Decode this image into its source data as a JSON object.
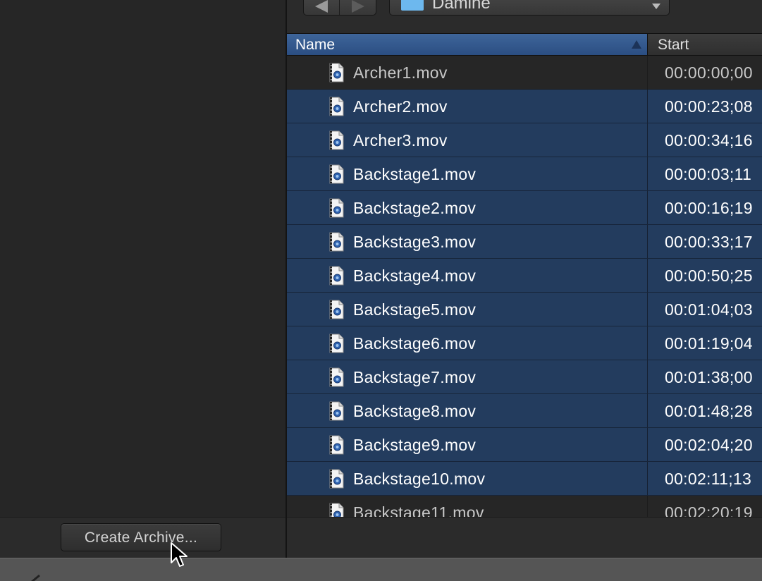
{
  "toolbar": {
    "location": "Damine",
    "folder_color": "#6db8ee"
  },
  "table": {
    "columns": {
      "name": "Name",
      "start": "Start"
    },
    "sort_direction": "ascending",
    "rows": [
      {
        "name": "Archer1.mov",
        "start": "00:00:00;00",
        "selected": false
      },
      {
        "name": "Archer2.mov",
        "start": "00:00:23;08",
        "selected": true
      },
      {
        "name": "Archer3.mov",
        "start": "00:00:34;16",
        "selected": true
      },
      {
        "name": "Backstage1.mov",
        "start": "00:00:03;11",
        "selected": true
      },
      {
        "name": "Backstage2.mov",
        "start": "00:00:16;19",
        "selected": true
      },
      {
        "name": "Backstage3.mov",
        "start": "00:00:33;17",
        "selected": true
      },
      {
        "name": "Backstage4.mov",
        "start": "00:00:50;25",
        "selected": true
      },
      {
        "name": "Backstage5.mov",
        "start": "00:01:04;03",
        "selected": true
      },
      {
        "name": "Backstage6.mov",
        "start": "00:01:19;04",
        "selected": true
      },
      {
        "name": "Backstage7.mov",
        "start": "00:01:38;00",
        "selected": true
      },
      {
        "name": "Backstage8.mov",
        "start": "00:01:48;28",
        "selected": true
      },
      {
        "name": "Backstage9.mov",
        "start": "00:02:04;20",
        "selected": true
      },
      {
        "name": "Backstage10.mov",
        "start": "00:02:11;13",
        "selected": true
      },
      {
        "name": "Backstage11.mov",
        "start": "00:02:20;19",
        "selected": false
      }
    ]
  },
  "footer": {
    "create_archive_label": "Create Archive..."
  },
  "colors": {
    "selection": "#233c5e",
    "header_selected": "#3e659a",
    "background": "#262626"
  },
  "icons": {
    "row_icon": "quicktime-movie-file-icon",
    "nav_back": "back-arrow-icon",
    "nav_forward": "forward-arrow-icon",
    "location": "folder-icon",
    "popup": "chevron-down-icon",
    "sort": "sort-ascending-icon",
    "cursor": "mouse-pointer-icon"
  }
}
